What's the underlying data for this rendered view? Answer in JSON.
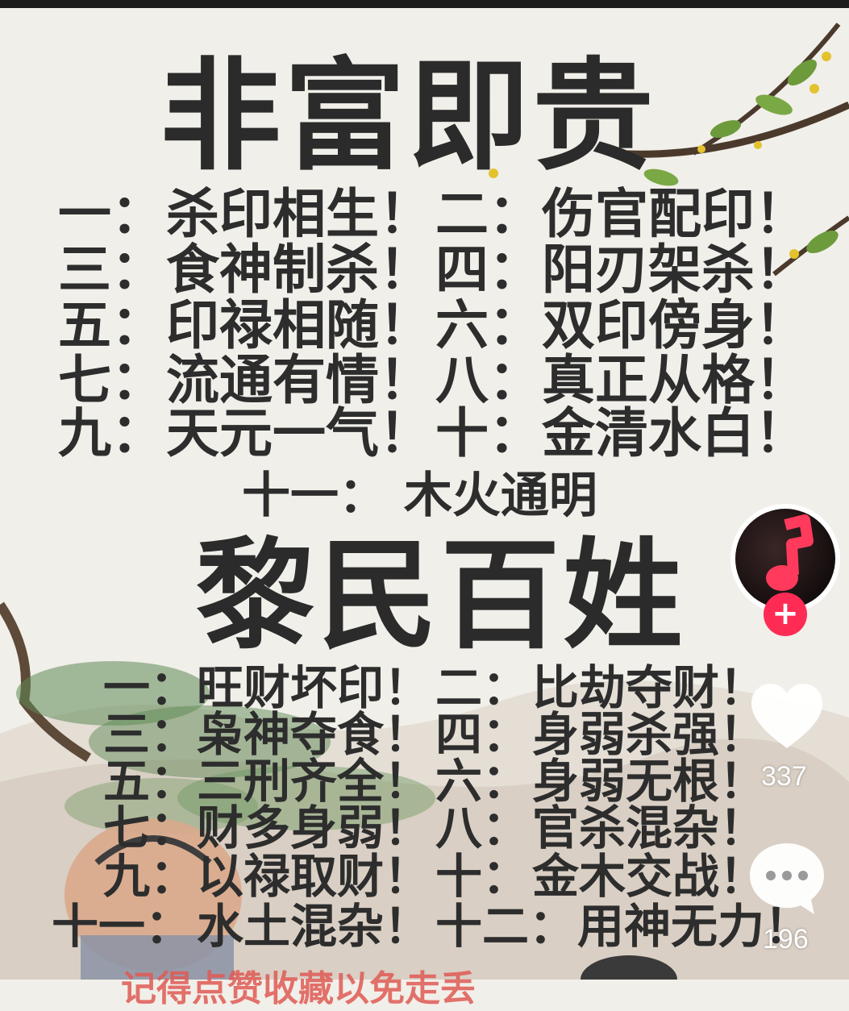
{
  "rich": {
    "title": "非富即贵",
    "rows": [
      {
        "lnum": "一：",
        "ltxt": "杀印相生！",
        "rnum": "二：",
        "rtxt": "伤官配印！"
      },
      {
        "lnum": "三：",
        "ltxt": "食神制杀！",
        "rnum": "四：",
        "rtxt": "阳刃架杀！"
      },
      {
        "lnum": "五：",
        "ltxt": "印禄相随！",
        "rnum": "六：",
        "rtxt": "双印傍身！"
      },
      {
        "lnum": "七：",
        "ltxt": "流通有情！",
        "rnum": "八：",
        "rtxt": "真正从格！"
      },
      {
        "lnum": "九：",
        "ltxt": "天元一气！",
        "rnum": "十：",
        "rtxt": "金清水白！"
      }
    ],
    "last": "十一：  木火通明"
  },
  "poor": {
    "title": "黎民百姓",
    "rows": [
      {
        "lnum": "一：",
        "ltxt": "旺财坏印！",
        "rnum": "二：",
        "rtxt": "比劫夺财！"
      },
      {
        "lnum": "三：",
        "ltxt": "枭神夺食！",
        "rnum": "四：",
        "rtxt": "身弱杀强！"
      },
      {
        "lnum": "五：",
        "ltxt": "三刑齐全！",
        "rnum": "六：",
        "rtxt": "身弱无根！"
      },
      {
        "lnum": "七：",
        "ltxt": "财多身弱！",
        "rnum": "八：",
        "rtxt": "官杀混杂！"
      },
      {
        "lnum": "九：",
        "ltxt": "以禄取财！",
        "rnum": "十：",
        "rtxt": "金木交战！"
      },
      {
        "lnum": "十一：",
        "ltxt": "水土混杂！",
        "rnum": "十二：",
        "rtxt": "用神无力！"
      }
    ]
  },
  "bottom_text": "记得点赞收藏以免走丢",
  "actions": {
    "follow_icon": "plus-icon",
    "music_icon": "music-note-icon",
    "like_icon": "heart-icon",
    "like_count": "337",
    "comment_icon": "comment-icon",
    "comment_count": "196",
    "accent": "#fe2c55"
  }
}
